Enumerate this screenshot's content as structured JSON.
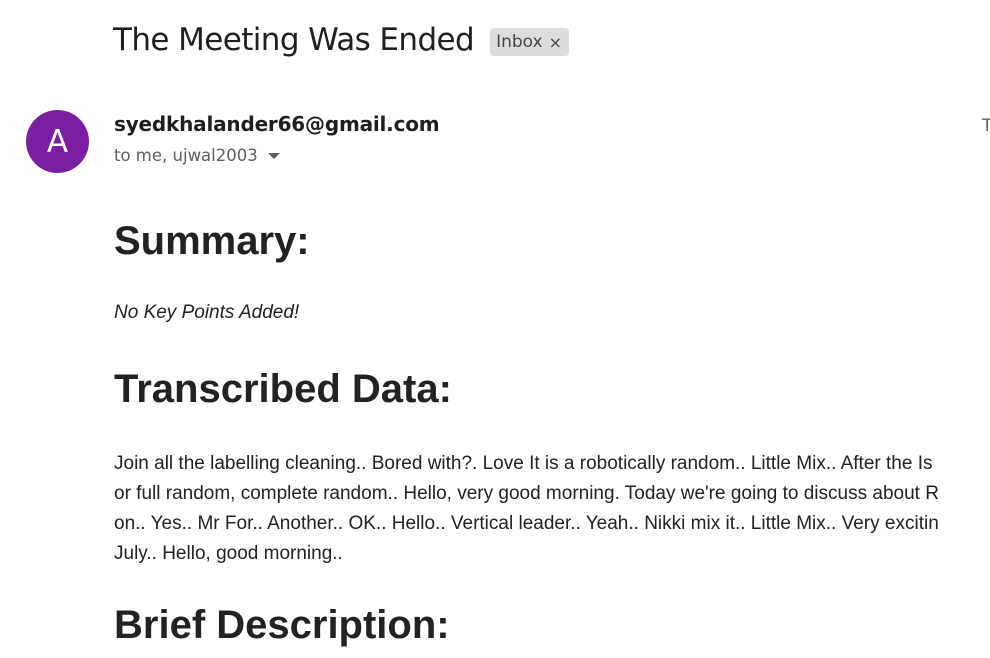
{
  "email": {
    "subject": "The Meeting Was Ended",
    "label": "Inbox",
    "label_remove": "×",
    "sender_initial": "A",
    "sender_email": "syedkhalander66@gmail.com",
    "recipients": "to me, ujwal2003",
    "date_partial": "T",
    "avatar_color": "#7b1fa2"
  },
  "body": {
    "summary_heading": "Summary:",
    "summary_text": "No Key Points Added!",
    "transcribed_heading": "Transcribed Data:",
    "transcript_lines": [
      "Join all the labelling cleaning.. Bored with?. Love It is a robotically random.. Little Mix.. After the Is",
      "or full random, complete random.. Hello, very good morning. Today we're going to discuss about R",
      "on.. Yes.. Mr For.. Another.. OK.. Hello.. Vertical leader.. Yeah.. Nikki mix it.. Little Mix.. Very excitin",
      "July.. Hello, good morning.."
    ],
    "brief_heading": "Brief Description:"
  }
}
